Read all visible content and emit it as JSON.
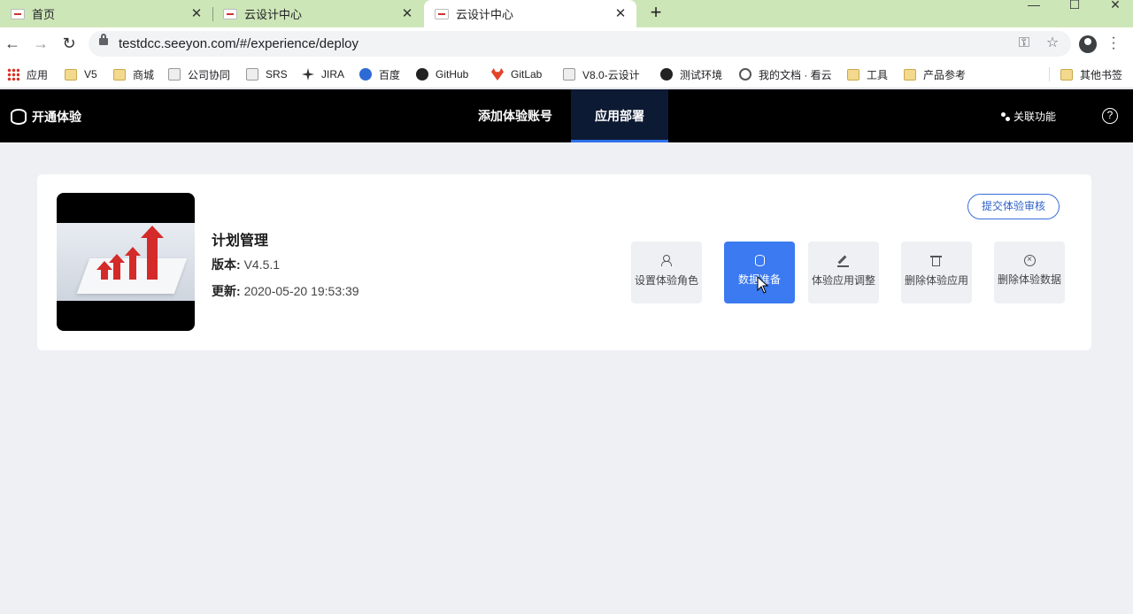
{
  "browser": {
    "tabs": [
      {
        "title": "首页",
        "active": false
      },
      {
        "title": "云设计中心",
        "active": false
      },
      {
        "title": "云设计中心",
        "active": true
      }
    ],
    "new_tab": "+",
    "url": "testdcc.seeyon.com/#/experience/deploy",
    "bookmarks": [
      {
        "label": "应用",
        "icon": "apps-icon"
      },
      {
        "label": "V5",
        "icon": "folder-icon"
      },
      {
        "label": "商城",
        "icon": "folder-icon"
      },
      {
        "label": "公司协同",
        "icon": "a8-logo-icon"
      },
      {
        "label": "SRS",
        "icon": "srs-logo-icon"
      },
      {
        "label": "JIRA",
        "icon": "jira-icon"
      },
      {
        "label": "百度",
        "icon": "baidu-paw-icon"
      },
      {
        "label": "GitHub",
        "icon": "github-icon"
      },
      {
        "label": "GitLab",
        "icon": "gitlab-icon"
      },
      {
        "label": "V8.0-云设计",
        "icon": "a8-logo-icon"
      },
      {
        "label": "测试环境",
        "icon": "globe-icon"
      },
      {
        "label": "我的文档 · 看云",
        "icon": "cloud-icon"
      },
      {
        "label": "工具",
        "icon": "folder-icon"
      },
      {
        "label": "产品参考",
        "icon": "folder-icon"
      }
    ],
    "other_bookmarks": "其他书签"
  },
  "header": {
    "brand": "开通体验",
    "nav": [
      {
        "label": "添加体验账号",
        "active": false
      },
      {
        "label": "应用部署",
        "active": true
      }
    ],
    "related": "关联功能",
    "help": "?"
  },
  "app": {
    "name": "计划管理",
    "version_label": "版本:",
    "version": "V4.5.1",
    "updated_label": "更新:",
    "updated": "2020-05-20 19:53:39",
    "submit_label": "提交体验审核",
    "actions": [
      {
        "label": "设置体验角色",
        "icon": "user-settings-icon",
        "primary": false
      },
      {
        "label": "数据准备",
        "icon": "database-icon",
        "primary": true
      },
      {
        "label": "体验应用调整",
        "icon": "edit-icon",
        "primary": false
      },
      {
        "label": "删除体验应用",
        "icon": "trash-icon",
        "primary": false
      },
      {
        "label": "删除体验数据",
        "icon": "x-circle-icon",
        "primary": false
      }
    ]
  },
  "colors": {
    "tabstrip": "#cde6b8",
    "header": "#000000",
    "active_nav_underline": "#2f6fec",
    "primary": "#3b7af0",
    "page_bg": "#eef0f4"
  }
}
